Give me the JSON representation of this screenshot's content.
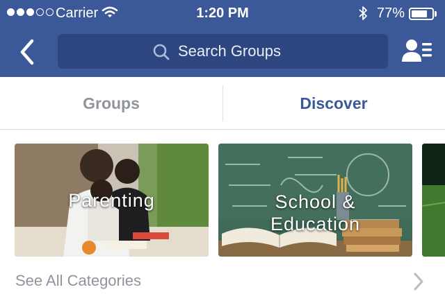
{
  "status_bar": {
    "carrier": "Carrier",
    "time": "1:20 PM",
    "battery": "77%",
    "battery_level": 0.77,
    "signal_bars_filled": 3,
    "signal_bars_total": 5
  },
  "navbar": {
    "back_icon": "chevron-left-icon",
    "search_placeholder": "Search Groups",
    "search_icon": "search-icon",
    "friends_icon": "friend-list-icon"
  },
  "tabs": [
    {
      "label": "Groups",
      "active": false
    },
    {
      "label": "Discover",
      "active": true
    }
  ],
  "categories": [
    {
      "line1": "Parenting",
      "line2": ""
    },
    {
      "line1": "School &",
      "line2": "Education"
    }
  ],
  "see_all": {
    "label": "See All Categories",
    "icon": "chevron-right-icon"
  },
  "colors": {
    "brand": "#3b5998",
    "search_bg": "#2d4680",
    "inactive_text": "#90949c",
    "divider": "#dcdee3"
  }
}
